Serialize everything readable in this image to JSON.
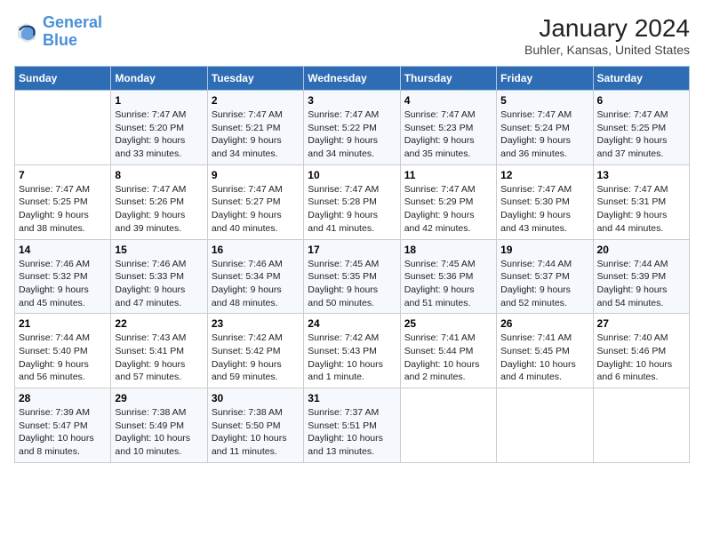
{
  "header": {
    "logo_line1": "General",
    "logo_line2": "Blue",
    "title": "January 2024",
    "subtitle": "Buhler, Kansas, United States"
  },
  "days_of_week": [
    "Sunday",
    "Monday",
    "Tuesday",
    "Wednesday",
    "Thursday",
    "Friday",
    "Saturday"
  ],
  "weeks": [
    [
      {
        "num": "",
        "info": ""
      },
      {
        "num": "1",
        "info": "Sunrise: 7:47 AM\nSunset: 5:20 PM\nDaylight: 9 hours\nand 33 minutes."
      },
      {
        "num": "2",
        "info": "Sunrise: 7:47 AM\nSunset: 5:21 PM\nDaylight: 9 hours\nand 34 minutes."
      },
      {
        "num": "3",
        "info": "Sunrise: 7:47 AM\nSunset: 5:22 PM\nDaylight: 9 hours\nand 34 minutes."
      },
      {
        "num": "4",
        "info": "Sunrise: 7:47 AM\nSunset: 5:23 PM\nDaylight: 9 hours\nand 35 minutes."
      },
      {
        "num": "5",
        "info": "Sunrise: 7:47 AM\nSunset: 5:24 PM\nDaylight: 9 hours\nand 36 minutes."
      },
      {
        "num": "6",
        "info": "Sunrise: 7:47 AM\nSunset: 5:25 PM\nDaylight: 9 hours\nand 37 minutes."
      }
    ],
    [
      {
        "num": "7",
        "info": "Sunrise: 7:47 AM\nSunset: 5:25 PM\nDaylight: 9 hours\nand 38 minutes."
      },
      {
        "num": "8",
        "info": "Sunrise: 7:47 AM\nSunset: 5:26 PM\nDaylight: 9 hours\nand 39 minutes."
      },
      {
        "num": "9",
        "info": "Sunrise: 7:47 AM\nSunset: 5:27 PM\nDaylight: 9 hours\nand 40 minutes."
      },
      {
        "num": "10",
        "info": "Sunrise: 7:47 AM\nSunset: 5:28 PM\nDaylight: 9 hours\nand 41 minutes."
      },
      {
        "num": "11",
        "info": "Sunrise: 7:47 AM\nSunset: 5:29 PM\nDaylight: 9 hours\nand 42 minutes."
      },
      {
        "num": "12",
        "info": "Sunrise: 7:47 AM\nSunset: 5:30 PM\nDaylight: 9 hours\nand 43 minutes."
      },
      {
        "num": "13",
        "info": "Sunrise: 7:47 AM\nSunset: 5:31 PM\nDaylight: 9 hours\nand 44 minutes."
      }
    ],
    [
      {
        "num": "14",
        "info": "Sunrise: 7:46 AM\nSunset: 5:32 PM\nDaylight: 9 hours\nand 45 minutes."
      },
      {
        "num": "15",
        "info": "Sunrise: 7:46 AM\nSunset: 5:33 PM\nDaylight: 9 hours\nand 47 minutes."
      },
      {
        "num": "16",
        "info": "Sunrise: 7:46 AM\nSunset: 5:34 PM\nDaylight: 9 hours\nand 48 minutes."
      },
      {
        "num": "17",
        "info": "Sunrise: 7:45 AM\nSunset: 5:35 PM\nDaylight: 9 hours\nand 50 minutes."
      },
      {
        "num": "18",
        "info": "Sunrise: 7:45 AM\nSunset: 5:36 PM\nDaylight: 9 hours\nand 51 minutes."
      },
      {
        "num": "19",
        "info": "Sunrise: 7:44 AM\nSunset: 5:37 PM\nDaylight: 9 hours\nand 52 minutes."
      },
      {
        "num": "20",
        "info": "Sunrise: 7:44 AM\nSunset: 5:39 PM\nDaylight: 9 hours\nand 54 minutes."
      }
    ],
    [
      {
        "num": "21",
        "info": "Sunrise: 7:44 AM\nSunset: 5:40 PM\nDaylight: 9 hours\nand 56 minutes."
      },
      {
        "num": "22",
        "info": "Sunrise: 7:43 AM\nSunset: 5:41 PM\nDaylight: 9 hours\nand 57 minutes."
      },
      {
        "num": "23",
        "info": "Sunrise: 7:42 AM\nSunset: 5:42 PM\nDaylight: 9 hours\nand 59 minutes."
      },
      {
        "num": "24",
        "info": "Sunrise: 7:42 AM\nSunset: 5:43 PM\nDaylight: 10 hours\nand 1 minute."
      },
      {
        "num": "25",
        "info": "Sunrise: 7:41 AM\nSunset: 5:44 PM\nDaylight: 10 hours\nand 2 minutes."
      },
      {
        "num": "26",
        "info": "Sunrise: 7:41 AM\nSunset: 5:45 PM\nDaylight: 10 hours\nand 4 minutes."
      },
      {
        "num": "27",
        "info": "Sunrise: 7:40 AM\nSunset: 5:46 PM\nDaylight: 10 hours\nand 6 minutes."
      }
    ],
    [
      {
        "num": "28",
        "info": "Sunrise: 7:39 AM\nSunset: 5:47 PM\nDaylight: 10 hours\nand 8 minutes."
      },
      {
        "num": "29",
        "info": "Sunrise: 7:38 AM\nSunset: 5:49 PM\nDaylight: 10 hours\nand 10 minutes."
      },
      {
        "num": "30",
        "info": "Sunrise: 7:38 AM\nSunset: 5:50 PM\nDaylight: 10 hours\nand 11 minutes."
      },
      {
        "num": "31",
        "info": "Sunrise: 7:37 AM\nSunset: 5:51 PM\nDaylight: 10 hours\nand 13 minutes."
      },
      {
        "num": "",
        "info": ""
      },
      {
        "num": "",
        "info": ""
      },
      {
        "num": "",
        "info": ""
      }
    ]
  ]
}
